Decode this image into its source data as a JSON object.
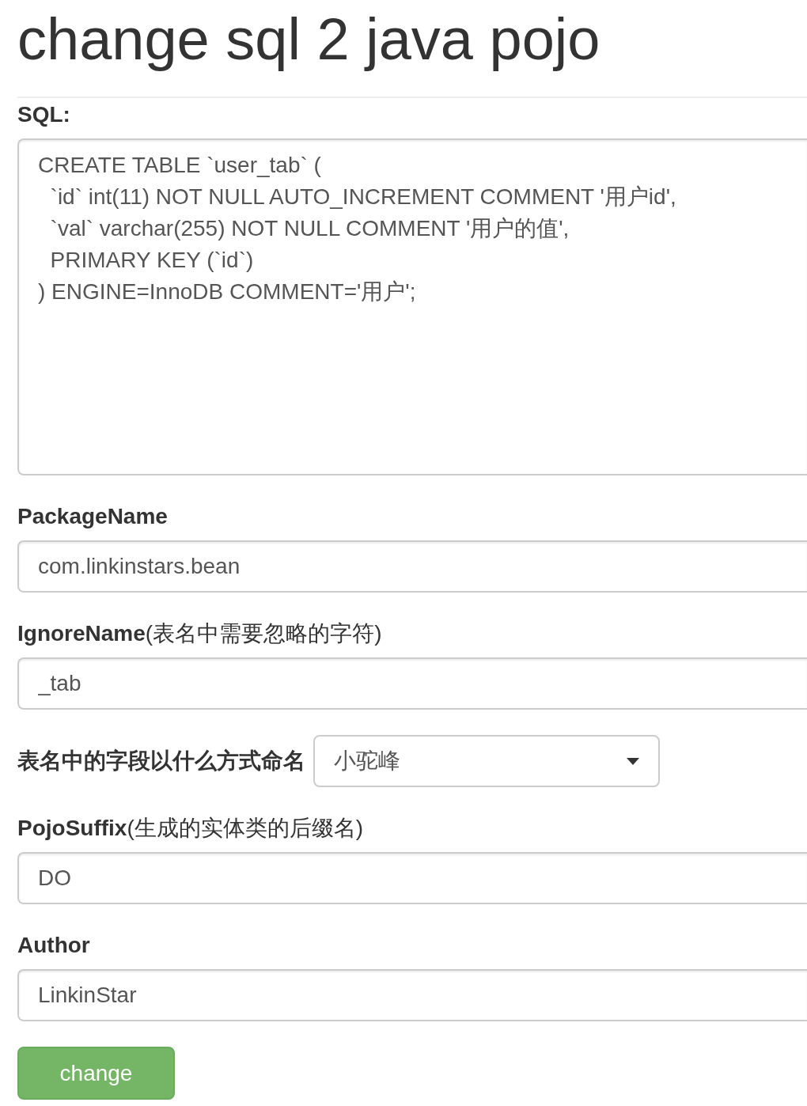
{
  "title": "change sql 2 java pojo",
  "fields": [
    {
      "kind": "textarea",
      "label": "SQL:",
      "value": "CREATE TABLE `user_tab` (\n  `id` int(11) NOT NULL AUTO_INCREMENT COMMENT '用户id',\n  `val` varchar(255) NOT NULL COMMENT '用户的值',\n  PRIMARY KEY (`id`)\n) ENGINE=InnoDB COMMENT='用户';"
    },
    {
      "kind": "input",
      "label": "PackageName",
      "value": "com.linkinstars.bean"
    },
    {
      "kind": "input",
      "label": "IgnoreName",
      "note": "(表名中需要忽略的字符)",
      "value": "_tab"
    },
    {
      "kind": "select",
      "label": "表名中的字段以什么方式命名",
      "value": "小驼峰"
    },
    {
      "kind": "input",
      "label": "PojoSuffix",
      "note": "(生成的实体类的后缀名)",
      "value": "DO"
    },
    {
      "kind": "input",
      "label": "Author",
      "value": "LinkinStar"
    }
  ],
  "button": "change"
}
